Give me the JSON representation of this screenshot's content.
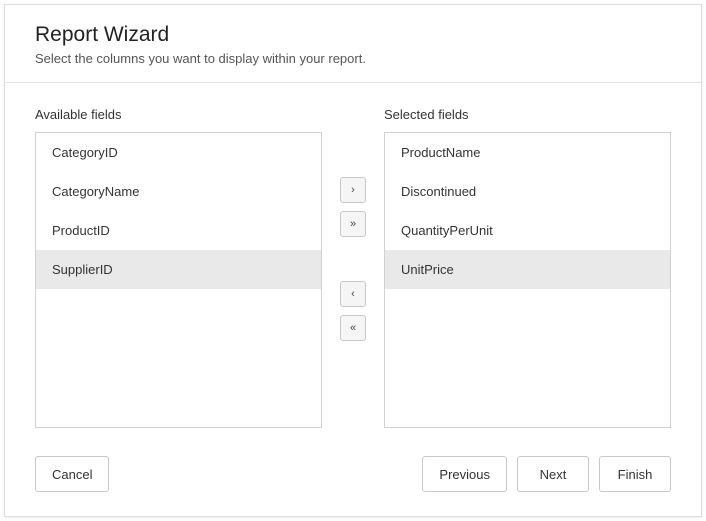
{
  "header": {
    "title": "Report Wizard",
    "subtitle": "Select the columns you want to display within your report."
  },
  "labels": {
    "available": "Available fields",
    "selected": "Selected fields"
  },
  "available": {
    "items": [
      {
        "label": "CategoryID"
      },
      {
        "label": "CategoryName"
      },
      {
        "label": "ProductID"
      },
      {
        "label": "SupplierID"
      }
    ],
    "selectedIndex": 3
  },
  "selected": {
    "items": [
      {
        "label": "ProductName"
      },
      {
        "label": "Discontinued"
      },
      {
        "label": "QuantityPerUnit"
      },
      {
        "label": "UnitPrice"
      }
    ],
    "selectedIndex": 3
  },
  "mover": {
    "add": "›",
    "addAll": "»",
    "remove": "‹",
    "removeAll": "«"
  },
  "footer": {
    "cancel": "Cancel",
    "previous": "Previous",
    "next": "Next",
    "finish": "Finish"
  }
}
